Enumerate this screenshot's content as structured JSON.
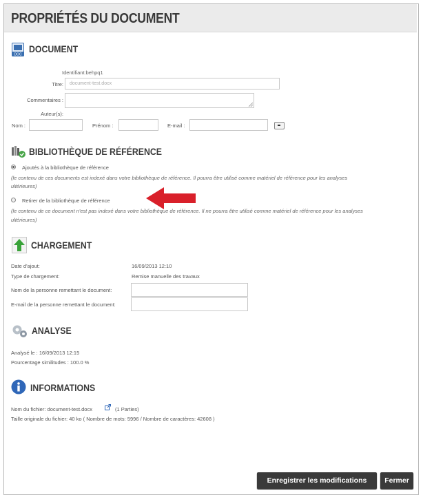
{
  "page_title": "PROPRIÉTÉS DU DOCUMENT",
  "document": {
    "heading": "DOCUMENT",
    "icon": "doc-icon",
    "identifiant": "Identifiant:behpq1",
    "titre_label": "Titre:",
    "titre_value": "document-test.docx",
    "commentaires_label": "Commentaires :",
    "auteurs_label": "Auteur(s):",
    "nom_label": "Nom :",
    "prenom_label": "Prénom :",
    "email_label": "E-mail :"
  },
  "bibliotheque": {
    "heading": "BIBLIOTHÈQUE DE RÉFÉRENCE",
    "icon": "books-check-icon",
    "option1_label": "Ajoutés à la bibliothèque de référence",
    "option1_note_1": "(le contenu de ces documents est indexé dans votre bibliothèque de référence. Il pourra être utilisé comme matériel de référence pour les analyses",
    "option1_note_2": "ultérieures)",
    "option2_label": "Retirer de la bibliothèque de référence",
    "option2_note_1": "(le contenu de ce document n'est pas indexé dans votre bibliothèque de référence. Il ne pourra être utilisé comme matériel de référence pour les analyses",
    "option2_note_2": "ultérieures)",
    "selected": "option1"
  },
  "chargement": {
    "heading": "CHARGEMENT",
    "icon": "upload-arrow-icon",
    "date_label": "Date d'ajout:",
    "date_value": "16/09/2013 12:10",
    "type_label": "Type de chargement:",
    "type_value": "Remise manuelle des travaux",
    "nom_label": "Nom de la personne remettant le document:",
    "email_label": "E-mail de la personne remettant le document:"
  },
  "analyse": {
    "heading": "ANALYSE",
    "icon": "gears-icon",
    "analyse_le": "Analysé le : 16/09/2013 12:15",
    "pourcentage": "Pourcentage similitudes : 100.0 %"
  },
  "informations": {
    "heading": "INFORMATIONS",
    "icon": "info-icon",
    "nom_fichier": "Nom du fichier: document-test.docx",
    "parties": "(1 Parties)",
    "taille": "Taille originale du fichier: 40 ko ( Nombre de mots: 5996 / Nombre de caractères: 42608 )"
  },
  "buttons": {
    "save": "Enregistrer les modifications",
    "close": "Fermer"
  },
  "colors": {
    "annotation_arrow": "#d9202a",
    "button_bg": "#3a3a3a"
  }
}
